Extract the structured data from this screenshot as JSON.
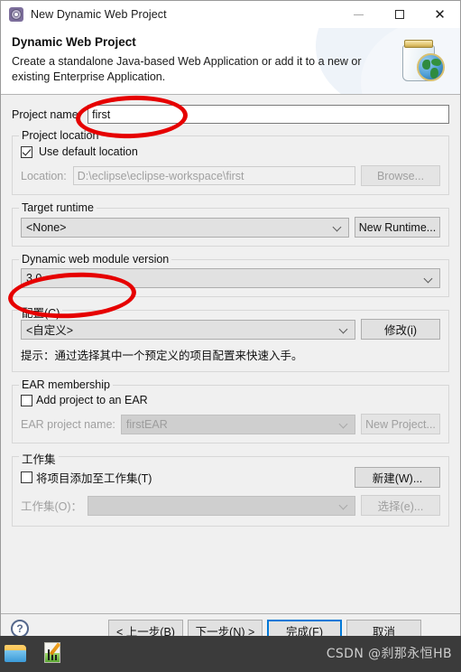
{
  "window": {
    "title": "New Dynamic Web Project",
    "icon": "eclipse-wizard-icon",
    "minimize_label": "",
    "maximize_label": "",
    "close_label": "✕"
  },
  "header": {
    "title": "Dynamic Web Project",
    "description": "Create a standalone Java-based Web Application or add it to a new or existing Enterprise Application.",
    "icon": "jar-globe-icon"
  },
  "project_name": {
    "label": "Project name:",
    "value": "first"
  },
  "project_location": {
    "group_title": "Project location",
    "use_default_label": "Use default location",
    "use_default_checked": true,
    "location_label": "Location:",
    "location_value": "D:\\eclipse\\eclipse-workspace\\first",
    "browse_label": "Browse..."
  },
  "target_runtime": {
    "group_title": "Target runtime",
    "value": "<None>",
    "new_runtime_label": "New Runtime..."
  },
  "module_version": {
    "group_title": "Dynamic web module version",
    "value": "3.0"
  },
  "configuration": {
    "group_title": "配置(C)",
    "value": "<自定义>",
    "modify_label": "修改(i)",
    "hint": "提示：通过选择其中一个预定义的项目配置来快速入手。"
  },
  "ear_membership": {
    "group_title": "EAR membership",
    "add_to_ear_label": "Add project to an EAR",
    "add_to_ear_checked": false,
    "ear_name_label": "EAR project name:",
    "ear_name_value": "firstEAR",
    "new_project_label": "New Project..."
  },
  "working_set": {
    "group_title": "工作集",
    "add_to_ws_label": "将项目添加至工作集(T)",
    "add_to_ws_checked": false,
    "new_label": "新建(W)...",
    "ws_label": "工作集(O)：",
    "ws_value": "",
    "select_label": "选择(e)..."
  },
  "footer": {
    "help_icon": "?",
    "back_label": "< 上一步(B)",
    "next_label": "下一步(N) >",
    "finish_label": "完成(F)",
    "cancel_label": "取消"
  },
  "annotations": [
    {
      "name": "project-name-highlight",
      "color": "#e60000"
    },
    {
      "name": "module-version-highlight",
      "color": "#e60000"
    }
  ],
  "taskbar": {
    "watermark": "CSDN @刹那永恒HB",
    "items": [
      "file-explorer-icon",
      "notepad-icon"
    ]
  }
}
